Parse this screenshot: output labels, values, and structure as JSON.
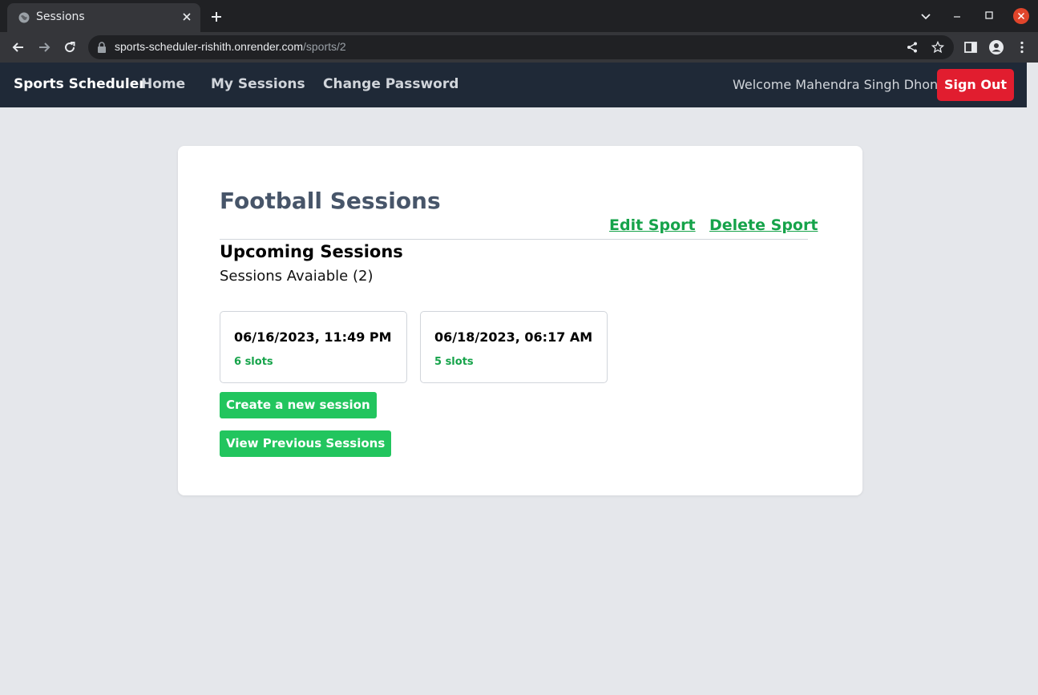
{
  "browser": {
    "tab_title": "Sessions",
    "url_host": "sports-scheduler-rishith.onrender.com",
    "url_path": "/sports/2"
  },
  "navbar": {
    "brand": "Sports Scheduler",
    "links": [
      "Home",
      "My Sessions",
      "Change Password"
    ],
    "welcome": "Welcome Mahendra Singh Dhoni",
    "signout_label": "Sign Out"
  },
  "main": {
    "title": "Football Sessions",
    "edit_label": "Edit Sport",
    "delete_label": "Delete Sport",
    "section_title": "Upcoming Sessions",
    "count_text": "Sessions Avaiable (2)",
    "sessions": [
      {
        "date": "06/16/2023, 11:49 PM",
        "slots": "6 slots"
      },
      {
        "date": "06/18/2023, 06:17 AM",
        "slots": "5 slots"
      }
    ],
    "create_label": "Create a new session",
    "previous_label": "View Previous Sessions"
  },
  "colors": {
    "navbar_bg": "#1f2937",
    "accent_green": "#22c55e",
    "link_green": "#16a34a",
    "signout_red": "#e11d2f",
    "page_bg": "#e5e7eb"
  }
}
